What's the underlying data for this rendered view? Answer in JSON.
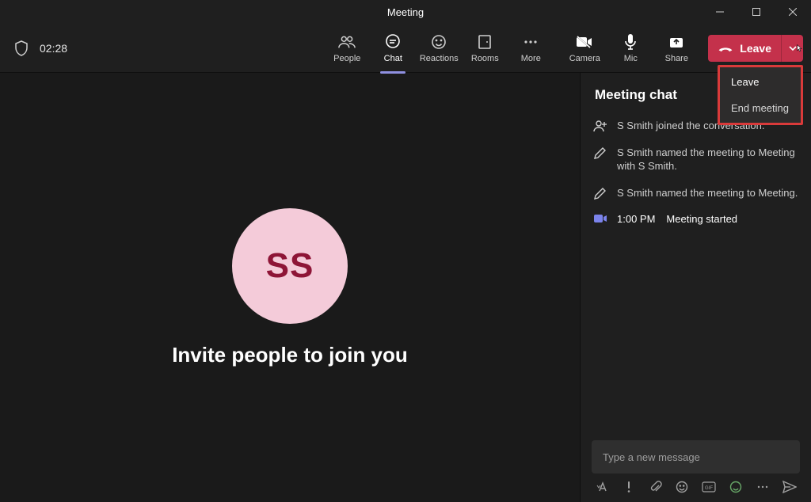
{
  "window": {
    "title": "Meeting"
  },
  "elapsed": "02:28",
  "tabs": {
    "people": "People",
    "chat": "Chat",
    "reactions": "Reactions",
    "rooms": "Rooms",
    "more": "More"
  },
  "controls": {
    "camera": "Camera",
    "mic": "Mic",
    "share": "Share"
  },
  "leave": {
    "label": "Leave"
  },
  "leave_menu": {
    "leave": "Leave",
    "end": "End meeting"
  },
  "stage": {
    "initials": "SS",
    "invite": "Invite people to join you"
  },
  "chat": {
    "title": "Meeting chat",
    "events": [
      {
        "icon": "person-add",
        "text": "S Smith joined the conversation."
      },
      {
        "icon": "pencil",
        "text": "S Smith named the meeting to Meeting with S Smith."
      },
      {
        "icon": "pencil",
        "text": "S Smith named the meeting to Meeting."
      },
      {
        "icon": "camera",
        "time": "1:00 PM",
        "text": "Meeting started"
      }
    ],
    "placeholder": "Type a new message"
  }
}
